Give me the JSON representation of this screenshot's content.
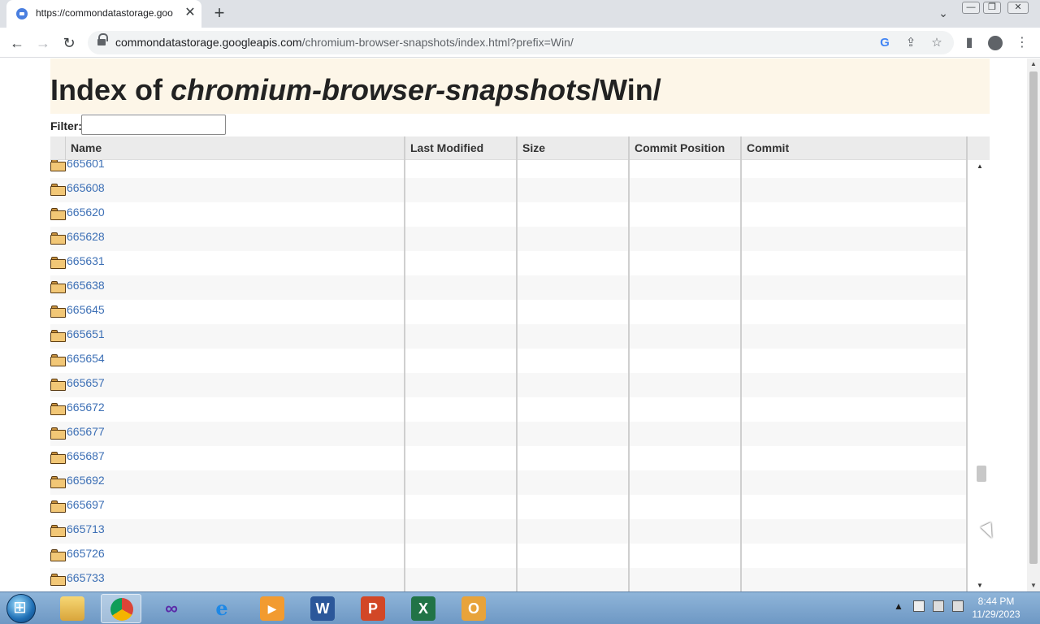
{
  "tab": {
    "title": "https://commondatastorage.goo",
    "close": "✕",
    "new": "+"
  },
  "window": {
    "chevron": "⌄",
    "minimize": "—",
    "restore": "❐",
    "close": "✕"
  },
  "toolbar": {
    "back": "←",
    "forward": "→",
    "reload": "↻"
  },
  "address": {
    "host": "commondatastorage.googleapis.com",
    "path": "/chromium-browser-snapshots/index.html?prefix=Win/"
  },
  "omnibox_icons": {
    "google": "G",
    "share": "⇪",
    "bookmark": "☆"
  },
  "browser_icons": {
    "sidepanel": "▮",
    "menu": "⋮"
  },
  "page": {
    "title_prefix": "Index of ",
    "title_bucket": "chromium-browser-snapshots",
    "title_suffix": "/Win/",
    "filter_label": "Filter:",
    "filter_value": ""
  },
  "columns": [
    "Name",
    "Last Modified",
    "Size",
    "Commit Position",
    "Commit"
  ],
  "rows": [
    "665601",
    "665608",
    "665620",
    "665628",
    "665631",
    "665638",
    "665645",
    "665651",
    "665654",
    "665657",
    "665672",
    "665677",
    "665687",
    "665692",
    "665697",
    "665713",
    "665726",
    "665733"
  ],
  "scroll": {
    "up": "▲",
    "down": "▼"
  },
  "taskbar": {
    "apps": [
      "explorer",
      "chrome",
      "visual-studio",
      "internet-explorer",
      "media-player",
      "word",
      "powerpoint",
      "excel",
      "outlook"
    ],
    "tray_arrow": "▲",
    "time": "8:44 PM",
    "date": "11/29/2023"
  },
  "colors": {
    "link": "#3c6fb5",
    "header_band": "#fdf6e8",
    "row_alt": "#f7f7f7",
    "grid_header": "#ebebeb"
  }
}
